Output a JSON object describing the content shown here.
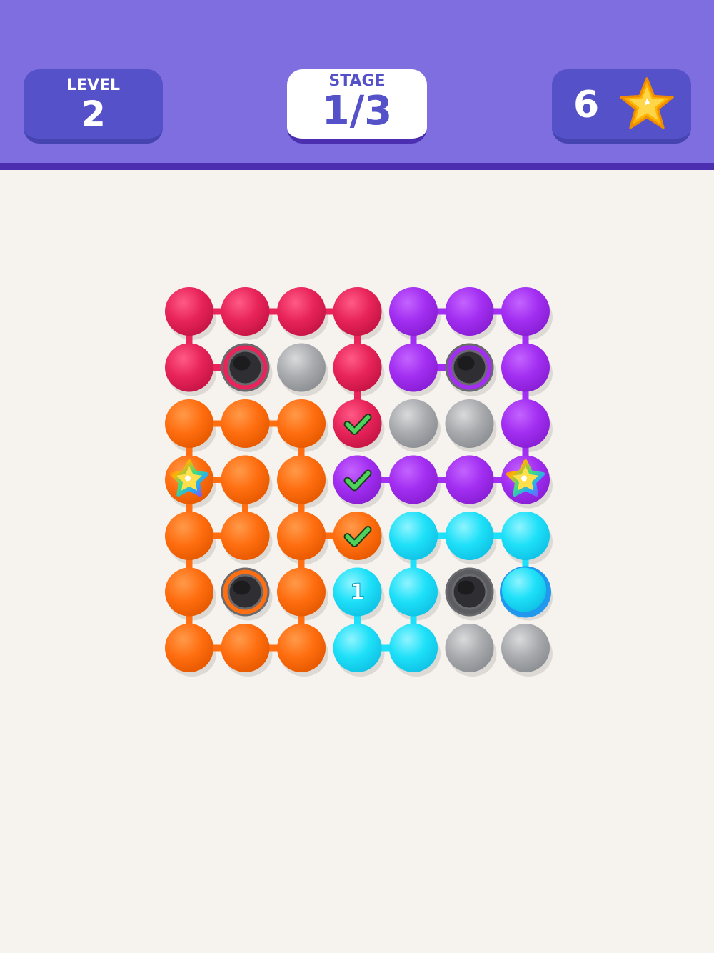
{
  "header": {
    "level_label": "LEVEL",
    "level_value": "2",
    "stage_label": "STAGE",
    "stage_value": "1/3",
    "stars_count": "6"
  },
  "colors": {
    "red": "#e8245a",
    "purple": "#a22ef1",
    "orange": "#ff6e10",
    "cyan": "#1ee0f8",
    "gray": "#a9abae",
    "hole": "#2f2f33",
    "link_red": "#e8245a",
    "link_purple": "#a22ef1",
    "link_orange": "#ff6e10",
    "link_cyan": "#1ee0f8"
  },
  "grid": {
    "rows": 7,
    "cols": 7,
    "cells": [
      [
        "red",
        "red",
        "red",
        "red",
        "purple",
        "purple",
        "purple"
      ],
      [
        "red",
        "hole-red",
        "gray",
        "red",
        "purple",
        "hole-purple",
        "purple"
      ],
      [
        "orange",
        "orange",
        "orange",
        "red",
        "gray",
        "gray",
        "purple"
      ],
      [
        "orange",
        "orange",
        "orange",
        "purple",
        "purple",
        "purple",
        "purple"
      ],
      [
        "orange",
        "orange",
        "orange",
        "orange",
        "cyan",
        "cyan",
        "cyan"
      ],
      [
        "orange",
        "hole-orange",
        "orange",
        "cyan",
        "cyan",
        "hole-gray",
        "cyan"
      ],
      [
        "orange",
        "orange",
        "orange",
        "cyan",
        "cyan",
        "gray",
        "gray"
      ]
    ],
    "badges": [
      {
        "row": 2,
        "col": 3,
        "icon": "check-icon"
      },
      {
        "row": 3,
        "col": 3,
        "icon": "check-icon"
      },
      {
        "row": 4,
        "col": 3,
        "icon": "check-icon"
      },
      {
        "row": 3,
        "col": 0,
        "icon": "rainbow-star-icon"
      },
      {
        "row": 3,
        "col": 6,
        "icon": "rainbow-star-icon"
      },
      {
        "row": 5,
        "col": 3,
        "text": "1"
      }
    ],
    "selected": {
      "row": 5,
      "col": 6
    },
    "links": [
      {
        "color": "red",
        "path": [
          [
            2,
            3
          ],
          [
            1,
            3
          ],
          [
            0,
            3
          ],
          [
            0,
            2
          ],
          [
            0,
            1
          ],
          [
            0,
            0
          ],
          [
            1,
            0
          ],
          [
            1,
            1
          ]
        ]
      },
      {
        "color": "purple",
        "path": [
          [
            3,
            3
          ],
          [
            3,
            4
          ],
          [
            3,
            5
          ],
          [
            3,
            6
          ],
          [
            2,
            6
          ],
          [
            1,
            6
          ],
          [
            0,
            6
          ],
          [
            0,
            5
          ],
          [
            0,
            4
          ],
          [
            1,
            4
          ],
          [
            1,
            5
          ]
        ]
      },
      {
        "color": "orange",
        "path": [
          [
            4,
            3
          ],
          [
            4,
            2
          ],
          [
            3,
            2
          ],
          [
            2,
            2
          ],
          [
            2,
            1
          ],
          [
            2,
            0
          ],
          [
            3,
            0
          ],
          [
            4,
            0
          ],
          [
            5,
            0
          ],
          [
            6,
            0
          ],
          [
            6,
            1
          ],
          [
            6,
            2
          ],
          [
            5,
            2
          ],
          [
            4,
            2
          ]
        ]
      },
      {
        "color": "orange",
        "path": [
          [
            3,
            0
          ],
          [
            3,
            1
          ],
          [
            4,
            1
          ],
          [
            4,
            0
          ]
        ]
      },
      {
        "color": "cyan",
        "path": [
          [
            5,
            3
          ],
          [
            6,
            3
          ],
          [
            6,
            4
          ],
          [
            5,
            4
          ],
          [
            4,
            4
          ],
          [
            4,
            5
          ],
          [
            4,
            6
          ],
          [
            5,
            6
          ]
        ]
      }
    ]
  }
}
